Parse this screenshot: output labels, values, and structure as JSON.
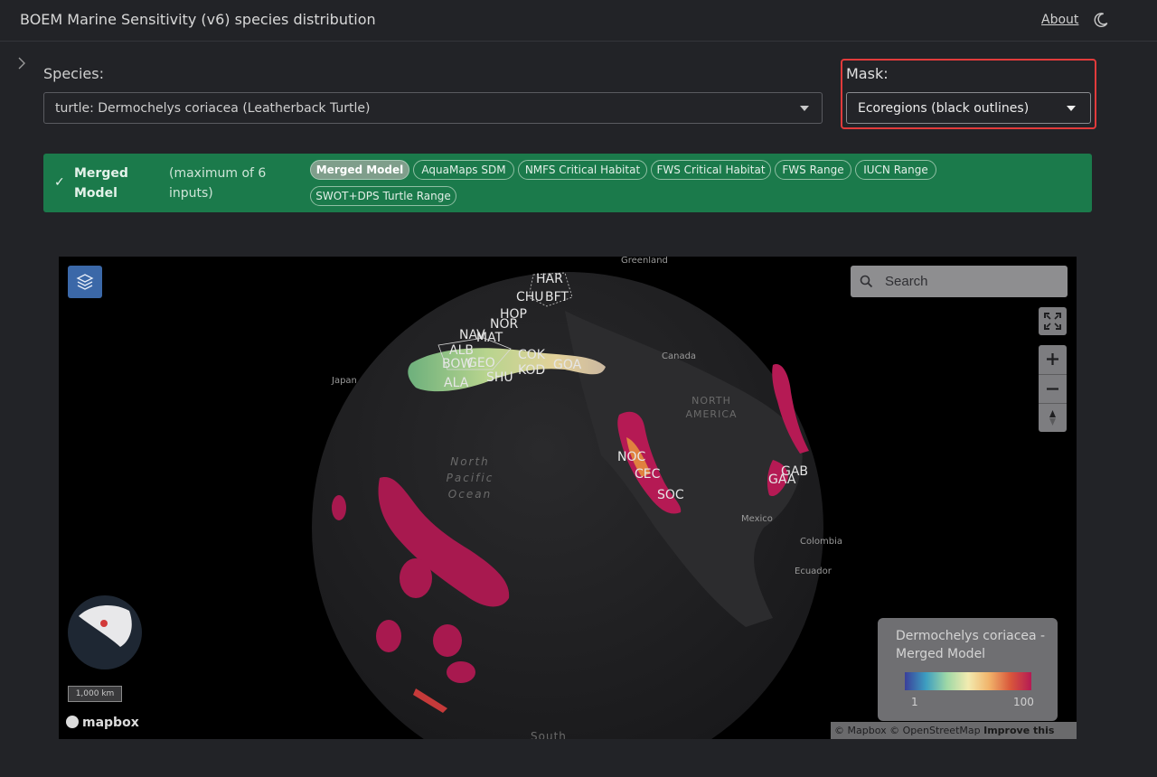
{
  "header": {
    "title": "BOEM Marine Sensitivity (v6) species distribution",
    "about_label": "About",
    "theme_icon": "moon-icon"
  },
  "species": {
    "label": "Species:",
    "selected": "turtle: Dermochelys coriacea (Leatherback Turtle)"
  },
  "mask": {
    "label": "Mask:",
    "selected": "Ecoregions (black outlines)"
  },
  "model_panel": {
    "title": "Merged Model",
    "note": "(maximum of 6 inputs)",
    "chips": [
      {
        "label": "Merged Model",
        "active": true
      },
      {
        "label": "AquaMaps SDM",
        "active": false
      },
      {
        "label": "NMFS Critical Habitat",
        "active": false
      },
      {
        "label": "FWS Critical Habitat",
        "active": false
      },
      {
        "label": "FWS Range",
        "active": false
      },
      {
        "label": "IUCN Range",
        "active": false
      },
      {
        "label": "SWOT+DPS Turtle Range",
        "active": false
      }
    ]
  },
  "map": {
    "search_placeholder": "Search",
    "place_labels": {
      "greenland": "Greenland",
      "canada": "Canada",
      "japan": "Japan",
      "north_america": "NORTH AMERICA",
      "north_pacific": "North Pacific Ocean",
      "mexico": "Mexico",
      "colombia": "Colombia",
      "ecuador": "Ecuador",
      "south": "South"
    },
    "ecoregion_labels": [
      "HAR",
      "CHU",
      "BFT",
      "HOP",
      "NOR",
      "NAV",
      "MAT",
      "ALB",
      "BOW",
      "GEO",
      "COK",
      "KOD",
      "GOA",
      "ALA",
      "SHU",
      "NOC",
      "CEC",
      "SOC",
      "GAB",
      "GAA"
    ],
    "legend": {
      "title": "Dermochelys coriacea - Merged Model",
      "min": "1",
      "max": "100"
    },
    "scale": "1,000 km",
    "logo": "mapbox",
    "attribution": "© Mapbox © OpenStreetMap",
    "improve_label": "Improve this map"
  }
}
